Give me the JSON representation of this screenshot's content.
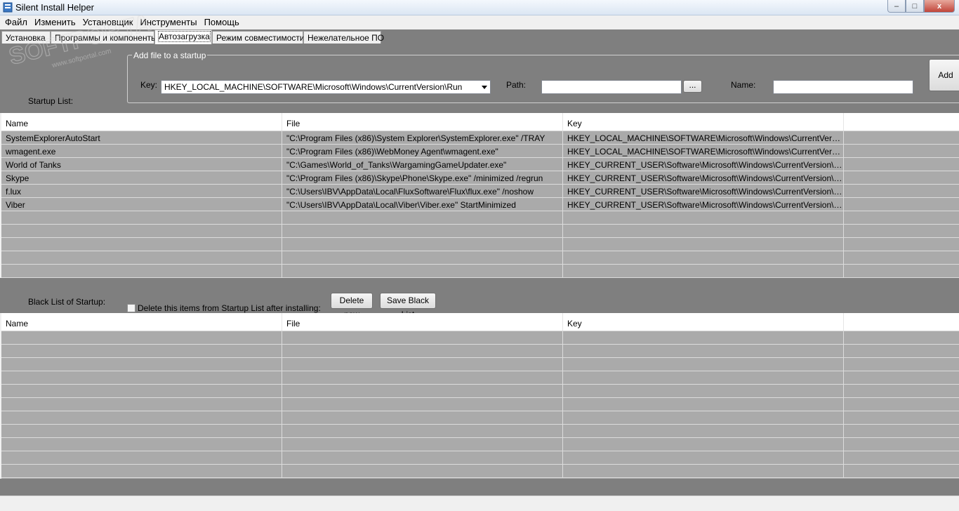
{
  "window": {
    "title": "Silent Install Helper",
    "minimize": "–",
    "maximize": "□",
    "close": "x"
  },
  "menu": [
    "Файл",
    "Изменить",
    "Установщик",
    "Инструменты",
    "Помощь"
  ],
  "tabs": [
    "Установка",
    "Программы и компоненты",
    "Автозагрузка",
    "Режим совместимости",
    "Нежелательное ПО"
  ],
  "active_tab": "Автозагрузка",
  "startup_form": {
    "group_title": "Add file to a startup",
    "startup_list_label": "Startup List:",
    "key_label": "Key:",
    "key_value": "HKEY_LOCAL_MACHINE\\SOFTWARE\\Microsoft\\Windows\\CurrentVersion\\Run",
    "path_label": "Path:",
    "path_value": "",
    "browse_button": "...",
    "name_label": "Name:",
    "name_value": "",
    "add_button": "Add"
  },
  "startup_table": {
    "columns": [
      "Name",
      "File",
      "Key"
    ],
    "rows": [
      [
        "SystemExplorerAutoStart",
        "\"C:\\Program Files (x86)\\System Explorer\\SystemExplorer.exe\" /TRAY",
        "HKEY_LOCAL_MACHINE\\SOFTWARE\\Microsoft\\Windows\\CurrentVersi..."
      ],
      [
        "wmagent.exe",
        "\"C:\\Program Files (x86)\\WebMoney Agent\\wmagent.exe\"",
        "HKEY_LOCAL_MACHINE\\SOFTWARE\\Microsoft\\Windows\\CurrentVersi..."
      ],
      [
        "World of Tanks",
        "\"C:\\Games\\World_of_Tanks\\WargamingGameUpdater.exe\"",
        "HKEY_CURRENT_USER\\Software\\Microsoft\\Windows\\CurrentVersion\\R..."
      ],
      [
        "Skype",
        "\"C:\\Program Files (x86)\\Skype\\Phone\\Skype.exe\" /minimized /regrun",
        "HKEY_CURRENT_USER\\Software\\Microsoft\\Windows\\CurrentVersion\\R..."
      ],
      [
        "f.lux",
        "\"C:\\Users\\IBV\\AppData\\Local\\FluxSoftware\\Flux\\flux.exe\" /noshow",
        "HKEY_CURRENT_USER\\Software\\Microsoft\\Windows\\CurrentVersion\\R..."
      ],
      [
        "Viber",
        "\"C:\\Users\\IBV\\AppData\\Local\\Viber\\Viber.exe\" StartMinimized",
        "HKEY_CURRENT_USER\\Software\\Microsoft\\Windows\\CurrentVersion\\R..."
      ]
    ]
  },
  "blacklist": {
    "label": "Black List of Startup:",
    "checkbox_label": "Delete this items from Startup List after installing:",
    "checked": false,
    "delete_button": "Delete now",
    "save_button": "Save Black List"
  },
  "blacklist_table": {
    "columns": [
      "Name",
      "File",
      "Key"
    ],
    "rows": []
  },
  "watermark": {
    "brand": "SOFTPORTAL",
    "url": "www.softportal.com",
    "color": "#d8d8d8"
  },
  "colors": {
    "panel_gray": "#7f7f7f",
    "grid_gray": "#aaaaaa"
  }
}
